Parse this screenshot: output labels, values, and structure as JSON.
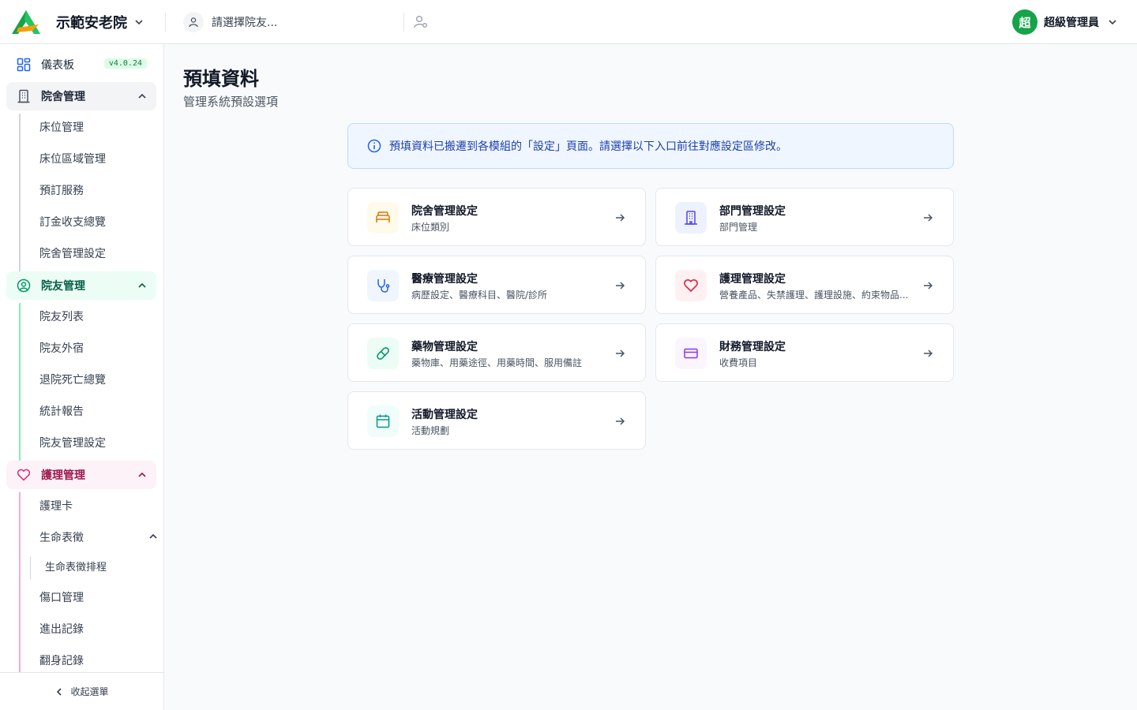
{
  "header": {
    "brand_name": "示範安老院",
    "resident_placeholder": "請選擇院友...",
    "user_initial": "超",
    "user_name": "超級管理員"
  },
  "colors": {
    "accent_green": "#16a34a",
    "facility": "#d97706",
    "department": "#4f46e5",
    "medical": "#2563eb",
    "nursing": "#e11d48",
    "medication": "#059669",
    "finance": "#9333ea",
    "activity": "#0d9488"
  },
  "sidebar": {
    "dashboard": "儀表板",
    "version": "v4.0.24",
    "facility": {
      "label": "院舍管理",
      "items": [
        "床位管理",
        "床位區域管理",
        "預訂服務",
        "訂金收支總覽",
        "院舍管理設定"
      ]
    },
    "resident": {
      "label": "院友管理",
      "items": [
        "院友列表",
        "院友外宿",
        "退院死亡總覽",
        "統計報告",
        "院友管理設定"
      ]
    },
    "nursing": {
      "label": "護理管理",
      "items": [
        "護理卡",
        "生命表徵",
        "生命表徵排程",
        "傷口管理",
        "進出記錄",
        "翻身記錄"
      ]
    },
    "collapse": "收起選單"
  },
  "main": {
    "title": "預填資料",
    "subtitle": "管理系統預設選項",
    "notice": "預填資料已搬遷到各模組的「設定」頁面。請選擇以下入口前往對應設定區修改。",
    "cards": [
      {
        "title": "院舍管理設定",
        "desc": "床位類別",
        "icon": "bed-icon"
      },
      {
        "title": "部門管理設定",
        "desc": "部門管理",
        "icon": "building-icon"
      },
      {
        "title": "醫療管理設定",
        "desc": "病歷設定、醫療科目、醫院/診所",
        "icon": "stethoscope-icon"
      },
      {
        "title": "護理管理設定",
        "desc": "營養產品、失禁護理、護理設施、約束物品...",
        "icon": "heart-icon"
      },
      {
        "title": "藥物管理設定",
        "desc": "藥物庫、用藥途徑、用藥時間、服用備註",
        "icon": "pill-icon"
      },
      {
        "title": "財務管理設定",
        "desc": "收費項目",
        "icon": "credit-card-icon"
      },
      {
        "title": "活動管理設定",
        "desc": "活動規劃",
        "icon": "calendar-icon"
      }
    ]
  }
}
